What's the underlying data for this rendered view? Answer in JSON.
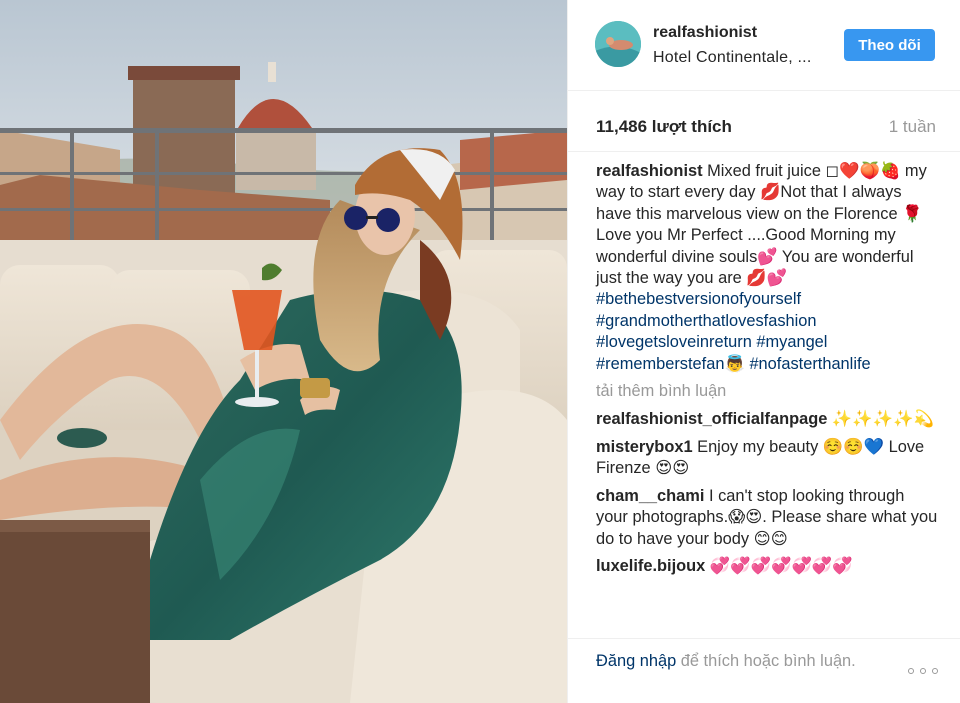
{
  "post": {
    "username": "realfashionist",
    "location": "Hotel Continentale, ...",
    "follow_label": "Theo dõi",
    "likes": "11,486 lượt thích",
    "time": "1 tuần"
  },
  "caption": {
    "username": "realfashionist",
    "text_1": " Mixed fruit juice ◻❤️🍑🍓 my way to start every day 💋Not that I always have this marvelous view on the Florence 🌹Love you Mr Perfect ....Good Morning my wonderful divine souls💕 You are wonderful just the way you are 💋💕 ",
    "tags": [
      "#bethebestversionofyourself",
      "#grandmotherthatlovesfashion",
      "#lovegetsloveinreturn",
      "#myangel",
      "#rememberstefan",
      "#nofasterthanlife"
    ],
    "tag_emoji": "👼"
  },
  "load_more": "tải thêm bình luận",
  "comments": [
    {
      "user": "realfashionist_officialfanpage",
      "text": " ✨✨✨✨💫"
    },
    {
      "user": "misterybox1",
      "text": " Enjoy my beauty ☺️☺️💙 Love Firenze 😍😍"
    },
    {
      "user": "cham__chami",
      "text": " I can't stop looking through your photographs.😱😍. Please share what you do to have your body 😊😊"
    },
    {
      "user": "luxelife.bijoux",
      "text": " 💞💞💞💞💞💞💞"
    }
  ],
  "footer": {
    "login_link": "Đăng nhập",
    "login_rest": " để thích hoặc bình luận."
  },
  "icons": {
    "more": "more-options-icon"
  },
  "colors": {
    "follow_button": "#3897f0",
    "hashtag": "#003569",
    "muted": "#999999"
  }
}
